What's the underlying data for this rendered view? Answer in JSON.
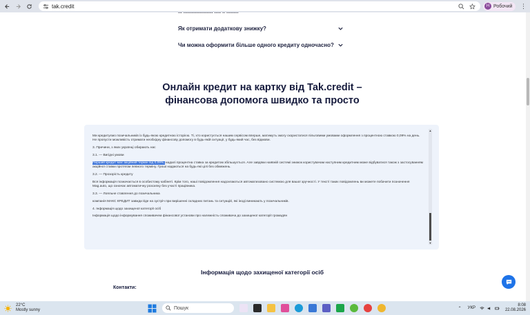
{
  "browser": {
    "url": "tak.credit",
    "profile_name": "Робочий",
    "profile_initial": "Н"
  },
  "faq": {
    "cut_item": "... ...................... ..... .. .........",
    "items": [
      {
        "question": "Як отримати додаткову знижку?"
      },
      {
        "question": "Чи можна оформити більше одного кредиту одночасно?"
      }
    ]
  },
  "headline": {
    "line1": "Онлайн кредит на картку від Tak.credit –",
    "line2": "фінансова допомога швидко та просто"
  },
  "article": {
    "p1": "Ми кредитуємо позичальників із будь-якою кредитною історією. Ті, хто користується нашим сервісом вперше, матимуть змогу скористатися пільговими умовами оформлення з процентною ставкою 0,09% на день. Не пропусти можливість отримати необхідну фінансову допомогу в будь-якій ситуації, у будь-який час, без відмови.",
    "p2": "3. Причини, з яких українці обирають нас",
    "p3": "3.1. — Вигідні умови",
    "p4_highlight": "Перший кредит має акційний термін під 0,09%,",
    "p4_rest": " надалі процентна ставка за кредитом збільшується. Але завдяки наявній системі знижок користувачам наступним кредитним може відбуватися також з застосуванням акційної ставки протягом певного терміну. Гроші надаються на будь-які цілі без обмежень.",
    "p5": "3.2. — Прозорість кредиту",
    "p6": "Вся інформація позначається в особистому кабінеті. Крім того, наші повідомлення надсилаються автоматизовано системою для вашої зручності. У тексті таких повідомлень ви можете побачити позначення Mag.auto, що означає автоматичну розсилку без участі працівника.",
    "p7": "3.3. — Лояльне ставлення до позичальника",
    "p8": "компанія МАКС КРЕДИТ завжди йде на зустріч при вирішенні складних питань та ситуацій, які іноді виникають у позичальників.",
    "p9": "4. Інформація щодо захищеної категорії осіб",
    "p10": "Інформація щодо інформування споживачем фінансової установи про належність споживача до захищеної категорії громадян"
  },
  "section_title": "Інформація щодо захищеної категорії осіб",
  "contacts_label": "Контакти:",
  "taskbar": {
    "temperature": "22°C",
    "weather": "Mostly sunny",
    "search_placeholder": "Пошук",
    "language": "УКР",
    "time": "8:08",
    "date": "22.08.2026"
  },
  "colors": {
    "accent": "#1e73e8",
    "heading": "#161b3d",
    "textbox_bg": "#eef3fb",
    "highlight": "#3b73d9"
  }
}
